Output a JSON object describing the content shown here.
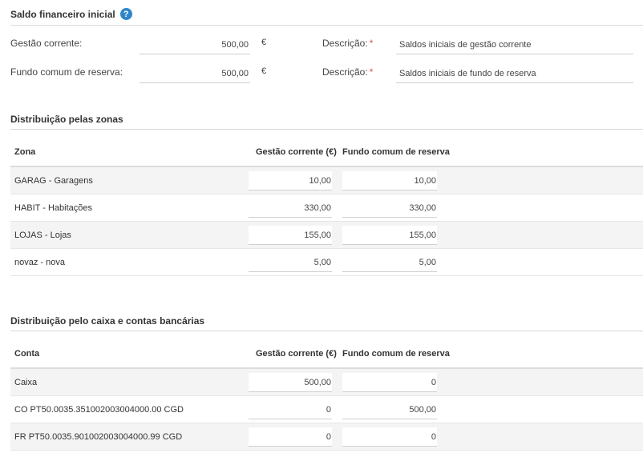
{
  "saldo": {
    "title": "Saldo financeiro inicial",
    "help_glyph": "?",
    "rows": [
      {
        "label": "Gestão corrente:",
        "value": "500,00",
        "currency": "€",
        "desc_label": "Descrição:",
        "required": "*",
        "desc_value": "Saldos iniciais de gestão corrente"
      },
      {
        "label": "Fundo comum de reserva:",
        "value": "500,00",
        "currency": "€",
        "desc_label": "Descrição:",
        "required": "*",
        "desc_value": "Saldos iniciais de fundo de reserva"
      }
    ]
  },
  "zonas": {
    "title": "Distribuição pelas zonas",
    "headers": [
      "Zona",
      "Gestão corrente (€)",
      "Fundo comum de reserva"
    ],
    "rows": [
      {
        "name": "GARAG - Garagens",
        "gc": "10,00",
        "fcr": "10,00"
      },
      {
        "name": "HABIT - Habitações",
        "gc": "330,00",
        "fcr": "330,00"
      },
      {
        "name": "LOJAS - Lojas",
        "gc": "155,00",
        "fcr": "155,00"
      },
      {
        "name": "novaz - nova",
        "gc": "5,00",
        "fcr": "5,00"
      }
    ]
  },
  "contas": {
    "title": "Distribuição pelo caixa e contas bancárias",
    "headers": [
      "Conta",
      "Gestão corrente (€)",
      "Fundo comum de reserva"
    ],
    "rows": [
      {
        "name": "Caixa",
        "gc": "500,00",
        "fcr": "0"
      },
      {
        "name": "CO PT50.0035.351002003004000.00 CGD",
        "gc": "0",
        "fcr": "500,00"
      },
      {
        "name": "FR PT50.0035.901002003004000.99 CGD",
        "gc": "0",
        "fcr": "0"
      }
    ]
  }
}
